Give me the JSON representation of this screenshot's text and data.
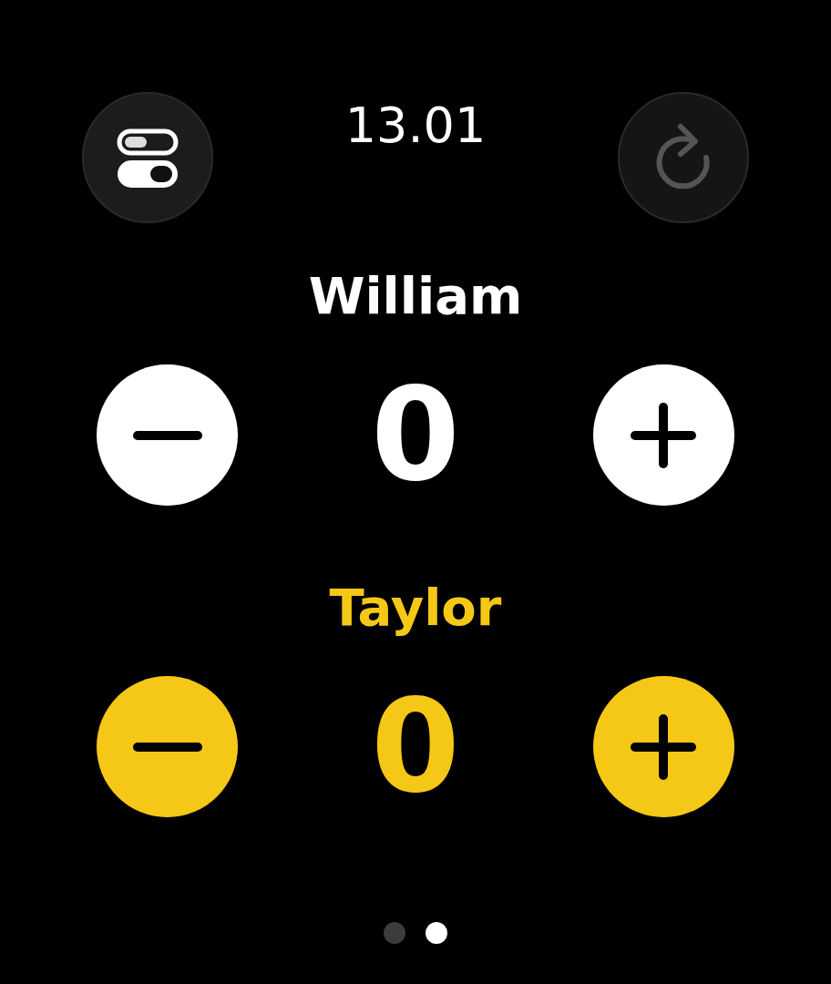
{
  "time": "13.01",
  "reset_button": {
    "disabled": true
  },
  "players": [
    {
      "name": "William",
      "score": "0",
      "color": "#ffffff"
    },
    {
      "name": "Taylor",
      "score": "0",
      "color": "#f5c817"
    }
  ],
  "page_dots": [
    {
      "selected": false
    },
    {
      "selected": true
    }
  ]
}
